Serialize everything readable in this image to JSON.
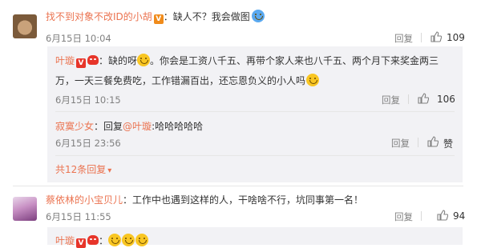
{
  "comments": [
    {
      "name": "找不到对象不改ID的小胡",
      "colon": "：",
      "text": "缺人不？我会做图",
      "time": "6月15日 10:04",
      "reply_label": "回复",
      "likes": "109",
      "replies": [
        {
          "name": "叶璇",
          "colon": "：",
          "text_line1_a": "缺的呀",
          "text_line1_b": "。你会是工资八千五、再带个家人来也八千五、两个月下来奖金两三",
          "text_line2": "万，一天三餐免费吃，工作错漏百出，还忘恩负义的小人吗",
          "time": "6月15日 10:15",
          "reply_label": "回复",
          "likes": "106"
        },
        {
          "name": "寂寞少女",
          "colon": "：",
          "text_prefix": "回复",
          "mention": "@叶璇",
          "text_suffix": ":哈哈哈哈哈",
          "time": "6月15日 23:56",
          "reply_label": "回复",
          "likes_label": "赞"
        }
      ],
      "more_replies": "共12条回复"
    },
    {
      "name": "蔡依林的小宝贝儿",
      "colon": "：",
      "text": "工作中也遇到这样的人，干啥啥不行，坑同事第一名！",
      "time": "6月15日 11:55",
      "reply_label": "回复",
      "likes": "94",
      "replies": [
        {
          "name": "叶璇",
          "colon": "："
        }
      ]
    }
  ],
  "colors": {
    "name": "#eb7350",
    "text": "#333333",
    "meta": "#808080",
    "reply_bg": "#f2f2f5"
  },
  "icons": {
    "like": "thumbs-up-icon",
    "emoji": "smile-emoji-icon"
  }
}
